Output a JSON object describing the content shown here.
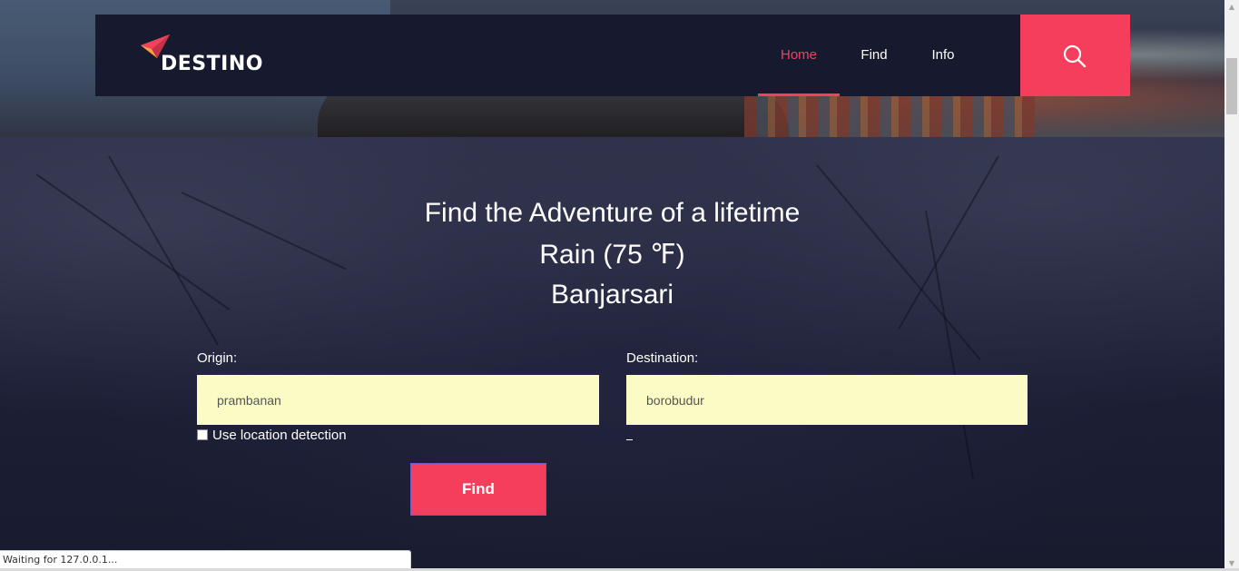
{
  "brand": {
    "name": "DESTINO"
  },
  "nav": {
    "items": [
      {
        "label": "Home",
        "active": true
      },
      {
        "label": "Find",
        "active": false
      },
      {
        "label": "Info",
        "active": false
      }
    ],
    "search_icon": "search-icon"
  },
  "hero": {
    "tagline": "Find the Adventure of a lifetime",
    "weather": "Rain (75 ℉)",
    "location": "Banjarsari"
  },
  "form": {
    "origin_label": "Origin:",
    "origin_value": "prambanan",
    "destination_label": "Destination:",
    "destination_value": "borobudur",
    "location_detection_label": "Use location detection",
    "location_detection_checked": false,
    "submit_label": "Find"
  },
  "status": {
    "text": "Waiting for 127.0.0.1..."
  },
  "colors": {
    "accent": "#f53e5b",
    "navbar": "#171a2e",
    "input_bg": "#fbfcc5"
  }
}
